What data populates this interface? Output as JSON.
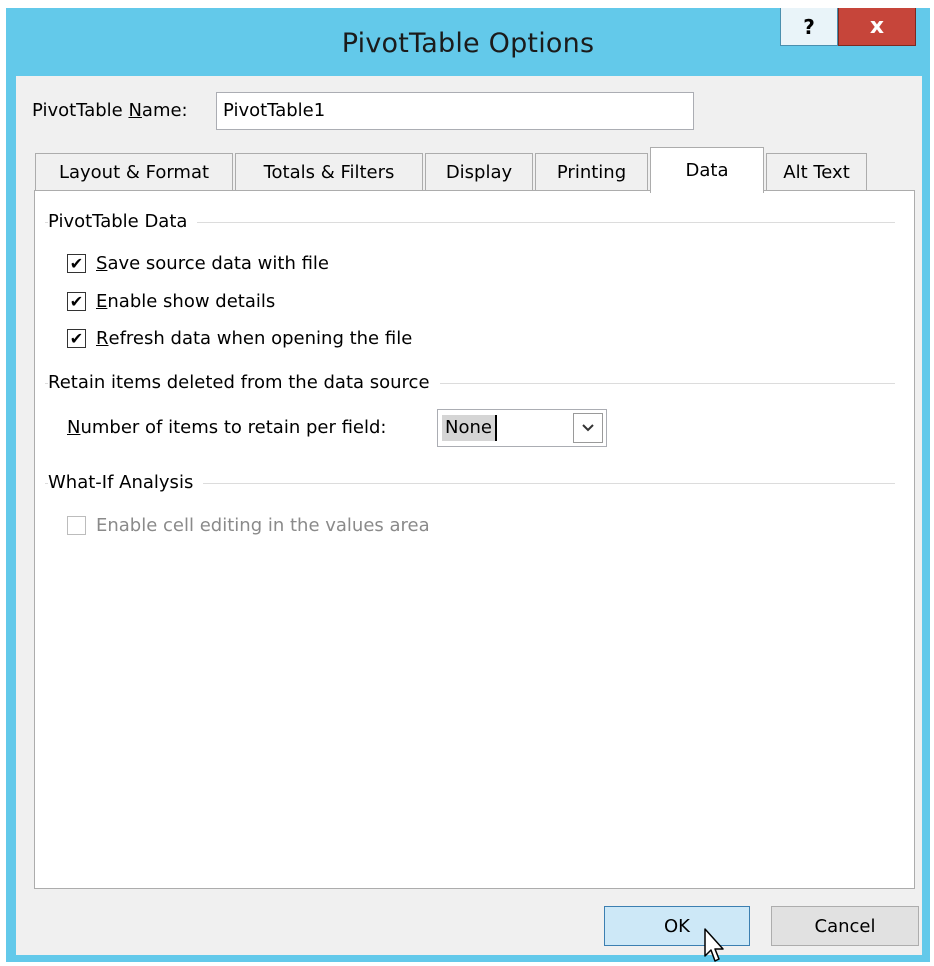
{
  "dialog": {
    "title": "PivotTable Options",
    "help_label": "?",
    "close_label": "x"
  },
  "name_field": {
    "label_pre": "PivotTable ",
    "label_accel": "N",
    "label_post": "ame:",
    "value": "PivotTable1"
  },
  "tabs": [
    {
      "label": "Layout & Format",
      "active": false
    },
    {
      "label": "Totals & Filters",
      "active": false
    },
    {
      "label": "Display",
      "active": false
    },
    {
      "label": "Printing",
      "active": false
    },
    {
      "label": "Data",
      "active": true
    },
    {
      "label": "Alt Text",
      "active": false
    }
  ],
  "sections": {
    "pivot_data": {
      "title": "PivotTable Data",
      "options": [
        {
          "accel": "S",
          "rest": "ave source data with file",
          "checked": true
        },
        {
          "accel": "E",
          "rest": "nable show details",
          "checked": true
        },
        {
          "accel": "R",
          "rest": "efresh data when opening the file",
          "checked": true
        }
      ]
    },
    "retain": {
      "title": "Retain items deleted from the data source",
      "label_accel": "N",
      "label_rest": "umber of items to retain per field:",
      "value": "None"
    },
    "whatif": {
      "title": "What-If Analysis",
      "option": {
        "label": "Enable cell editing in the values area",
        "checked": false,
        "disabled": true
      }
    }
  },
  "buttons": {
    "ok": "OK",
    "cancel": "Cancel"
  }
}
